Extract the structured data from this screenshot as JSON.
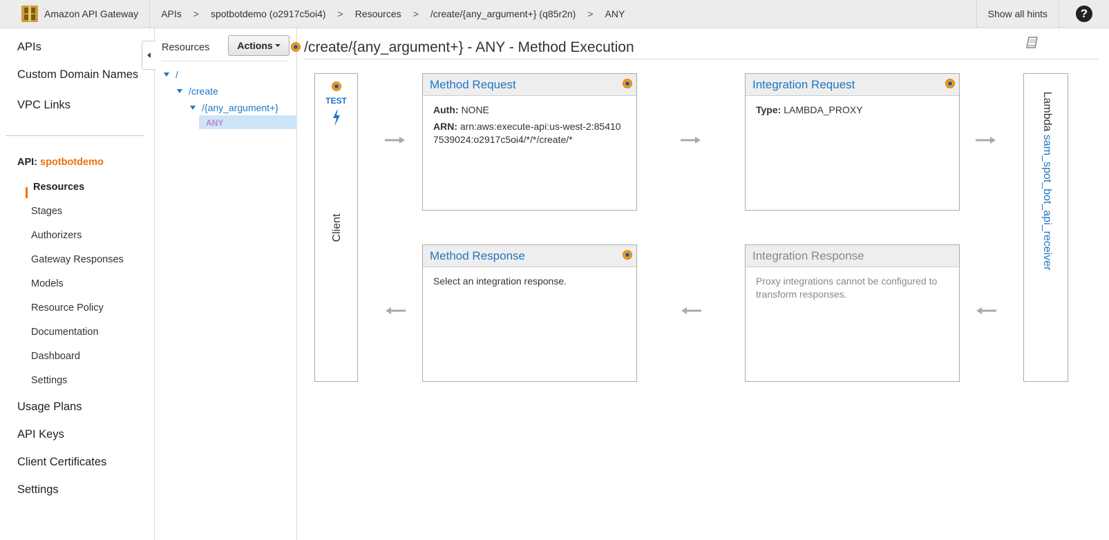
{
  "topbar": {
    "brand": "Amazon API Gateway",
    "breadcrumbs": [
      "APIs",
      "spotbotdemo (o2917c5oi4)",
      "Resources",
      "/create/{any_argument+} (q85r2n)",
      "ANY"
    ],
    "separator": ">",
    "show_hints": "Show all hints",
    "help": "?"
  },
  "leftnav": {
    "top_items": [
      "APIs",
      "Custom Domain Names",
      "VPC Links"
    ],
    "api_prefix": "API:",
    "api_name": "spotbotdemo",
    "sub_items": [
      "Resources",
      "Stages",
      "Authorizers",
      "Gateway Responses",
      "Models",
      "Resource Policy",
      "Documentation",
      "Dashboard",
      "Settings"
    ],
    "bottom_items": [
      "Usage Plans",
      "API Keys",
      "Client Certificates",
      "Settings"
    ]
  },
  "resources": {
    "title": "Resources",
    "actions": "Actions",
    "tree": [
      "/",
      "/create",
      "/{any_argument+}"
    ],
    "selected_method": "ANY"
  },
  "main": {
    "title": "/create/{any_argument+} - ANY - Method Execution",
    "client": {
      "test": "TEST",
      "label": "Client"
    },
    "method_request": {
      "title": "Method Request",
      "auth_label": "Auth:",
      "auth_value": "NONE",
      "arn_label": "ARN:",
      "arn_value": "arn:aws:execute-api:us-west-2:854107539024:o2917c5oi4/*/*/create/*"
    },
    "integration_request": {
      "title": "Integration Request",
      "type_label": "Type:",
      "type_value": "LAMBDA_PROXY"
    },
    "method_response": {
      "title": "Method Response",
      "body": "Select an integration response."
    },
    "integration_response": {
      "title": "Integration Response",
      "body": "Proxy integrations cannot be configured to transform responses."
    },
    "lambda": {
      "prefix": "Lambda",
      "function": "sam_spot_bot_api_receiver"
    }
  },
  "colors": {
    "accent": "#ec7211",
    "link": "#1f76c2",
    "arrow": "#aaaaaa"
  }
}
